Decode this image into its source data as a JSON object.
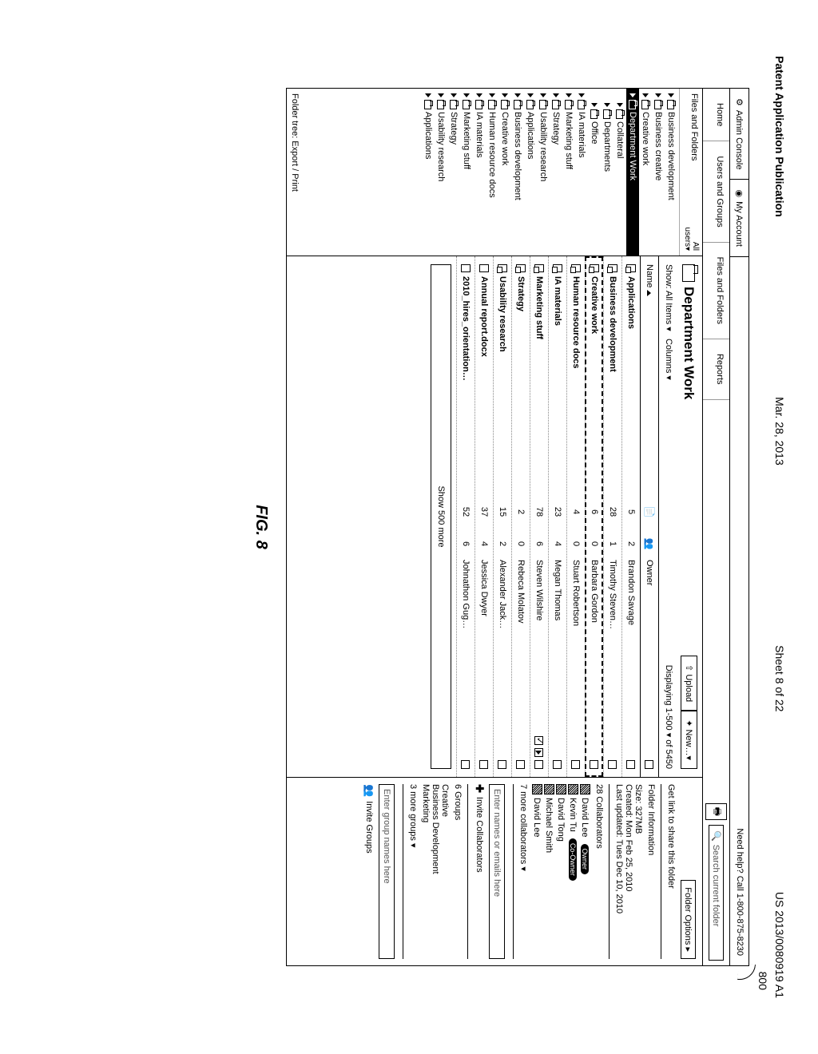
{
  "pub_header": {
    "left": "Patent Application Publication",
    "date": "Mar. 28, 2013",
    "sheet": "Sheet 8 of 22",
    "pubno": "US 2013/0080919 A1"
  },
  "ref_num": "800",
  "tabs": {
    "admin": "Admin Console",
    "myaccount": "My Account",
    "help": "Need help? Call 1-800-875-8230"
  },
  "nav": {
    "home": "Home",
    "users": "Users and Groups",
    "files": "Files and Folders",
    "reports": "Reports",
    "search_placeholder": "Search current folder"
  },
  "tree": {
    "header_left": "Files and Folders",
    "header_right_top": "All",
    "header_right_bottom": "users▾",
    "items": [
      {
        "label": "Business development",
        "level": 0
      },
      {
        "label": "Business creative",
        "level": 0
      },
      {
        "label": "Creative work",
        "level": 0
      },
      {
        "label": "Department Work",
        "level": 0,
        "selected": true
      },
      {
        "label": "Collateral",
        "level": 1
      },
      {
        "label": "Departments",
        "level": 1
      },
      {
        "label": "Office",
        "level": 1
      },
      {
        "label": "IA materials",
        "level": 0
      },
      {
        "label": "Marketing stuff",
        "level": 0
      },
      {
        "label": "Strategy",
        "level": 0
      },
      {
        "label": "Usability research",
        "level": 0
      },
      {
        "label": "Applications",
        "level": 0
      },
      {
        "label": "Business development",
        "level": 0
      },
      {
        "label": "Creative work",
        "level": 0
      },
      {
        "label": "Human resource docs",
        "level": 0
      },
      {
        "label": "IA materials",
        "level": 0
      },
      {
        "label": "Marketing stuff",
        "level": 0
      },
      {
        "label": "Strategy",
        "level": 0
      },
      {
        "label": "Usability research",
        "level": 0
      },
      {
        "label": "Applications",
        "level": 0
      }
    ],
    "footer": "Folder tree: Export / Print"
  },
  "center": {
    "title": "Department Work",
    "upload": "⇧ Upload",
    "new": "✦ New…▾",
    "show_label": "Show:",
    "show_value": "All Items ▾",
    "columns": "Columns ▾",
    "displaying": "Displaying 1-500 ▾ of 5450",
    "head_name": "Name",
    "head_owner": "Owner",
    "rows": [
      {
        "name": "Applications",
        "c1": "5",
        "c2": "2",
        "owner": "Brandon Savage",
        "type": "folder"
      },
      {
        "name": "Business development",
        "c1": "28",
        "c2": "1",
        "owner": "Timothy Steven…",
        "type": "folder"
      },
      {
        "name": "Creative work",
        "c1": "6",
        "c2": "0",
        "owner": "Barbara Gordon",
        "type": "folder",
        "selected": true
      },
      {
        "name": "Human resource docs",
        "c1": "4",
        "c2": "0",
        "owner": "Stuart Robertson",
        "type": "folder"
      },
      {
        "name": "IA materials",
        "c1": "23",
        "c2": "4",
        "owner": "Megan Thomas",
        "type": "folder"
      },
      {
        "name": "Marketing stuff",
        "c1": "78",
        "c2": "6",
        "owner": "Steven Wilshire",
        "type": "folder",
        "extra": true
      },
      {
        "name": "Strategy",
        "c1": "2",
        "c2": "0",
        "owner": "Rebeca Molatov",
        "type": "folder"
      },
      {
        "name": "Usability research",
        "c1": "15",
        "c2": "2",
        "owner": "Alexander Jack…",
        "type": "folder"
      },
      {
        "name": "Annual report.docx",
        "c1": "37",
        "c2": "4",
        "owner": "Jessica Dwyer",
        "type": "file"
      },
      {
        "name": "2010_hires_orientation…",
        "c1": "52",
        "c2": "6",
        "owner": "Johnathon Gug…",
        "type": "file"
      }
    ],
    "show_more": "Show 500 more"
  },
  "right": {
    "folder_options": "Folder Options      ▸",
    "share_link": "Get link to share this folder",
    "info_title": "Folder Information",
    "size": "Size: 327MB",
    "created": "Created: Mon Feb 25, 2010",
    "updated": "Last updated: Tues Dec 10, 2010",
    "collab_title": "28 Collaborators",
    "collabs": [
      {
        "name": "David Lee",
        "badge": "Owner"
      },
      {
        "name": "Kevin Tu",
        "badge": "Co-Owner"
      },
      {
        "name": "David Tong"
      },
      {
        "name": "Michael Smith"
      },
      {
        "name": "David Lee"
      }
    ],
    "more_collab": "7 more collaborators ▾",
    "enter_names": "Enter names or emails here",
    "invite_collab": "Invite Collaborators",
    "groups_title": "6 Groups",
    "groups": [
      "Creative",
      "Business Development",
      "Marketing"
    ],
    "more_groups": "3 more groups ▾",
    "enter_groups": "Enter group names here",
    "invite_groups": "Invite Groups"
  },
  "figure_caption": "FIG. 8"
}
